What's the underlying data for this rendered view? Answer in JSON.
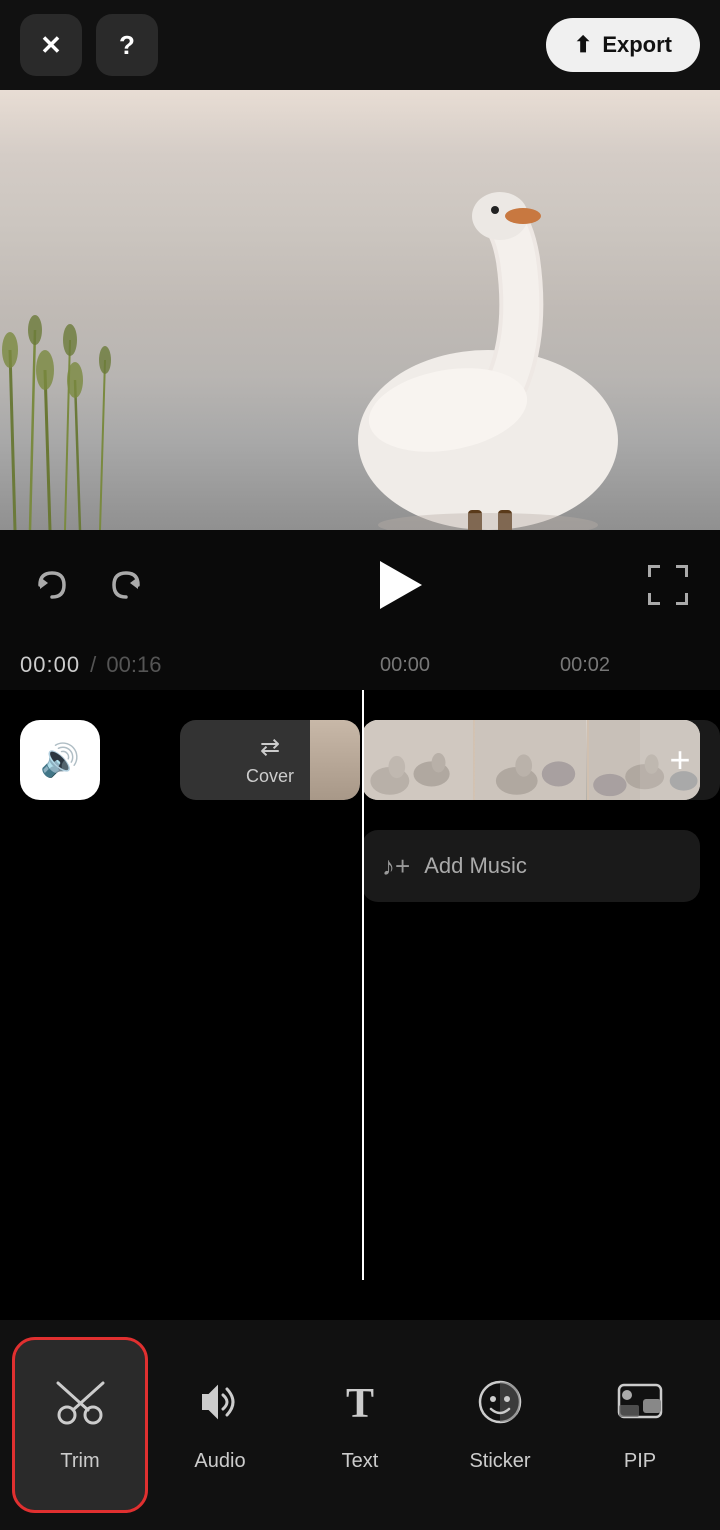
{
  "topBar": {
    "closeLabel": "✕",
    "helpLabel": "?",
    "exportLabel": "Export"
  },
  "controls": {
    "currentTime": "00:00",
    "totalTime": "00:16",
    "marker1": "00:00",
    "marker2": "00:02"
  },
  "timeline": {
    "coverLabel": "Cover",
    "addMusicLabel": "Add Music"
  },
  "toolbar": {
    "items": [
      {
        "id": "trim",
        "label": "Trim",
        "active": true
      },
      {
        "id": "audio",
        "label": "Audio",
        "active": false
      },
      {
        "id": "text",
        "label": "Text",
        "active": false
      },
      {
        "id": "sticker",
        "label": "Sticker",
        "active": false
      },
      {
        "id": "pip",
        "label": "PIP",
        "active": false
      }
    ]
  }
}
